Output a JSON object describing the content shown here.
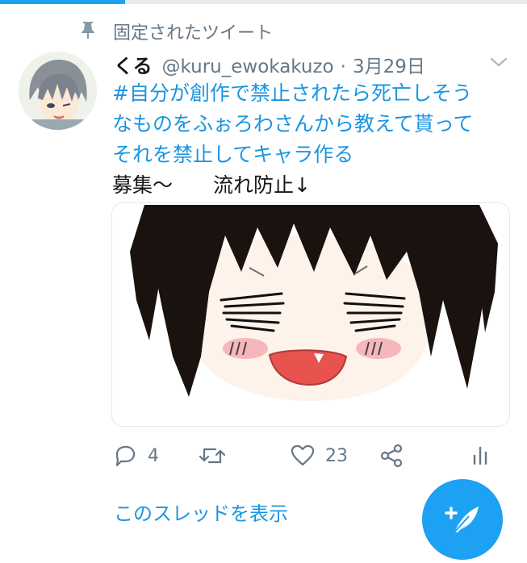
{
  "pinned": {
    "label": "固定されたツイート",
    "icon": "pin-icon"
  },
  "tweet": {
    "display_name": "くる",
    "handle": "@kuru_ewokakuzo",
    "separator": "·",
    "date": "3月29日",
    "text_lines": [
      "#自分が創作で禁止されたら死亡しそう",
      "なものをふぉろわさんから教えて貰って",
      "それを禁止してキャラ作る",
      "募集〜　　流れ防止↓"
    ],
    "actions": {
      "reply_count": "4",
      "retweet_count": "",
      "like_count": "23"
    }
  },
  "thread_link": "このスレッドを表示",
  "colors": {
    "accent": "#1da1f2",
    "link": "#1b95e0",
    "muted": "#657786",
    "divider": "#e6ecf0"
  }
}
